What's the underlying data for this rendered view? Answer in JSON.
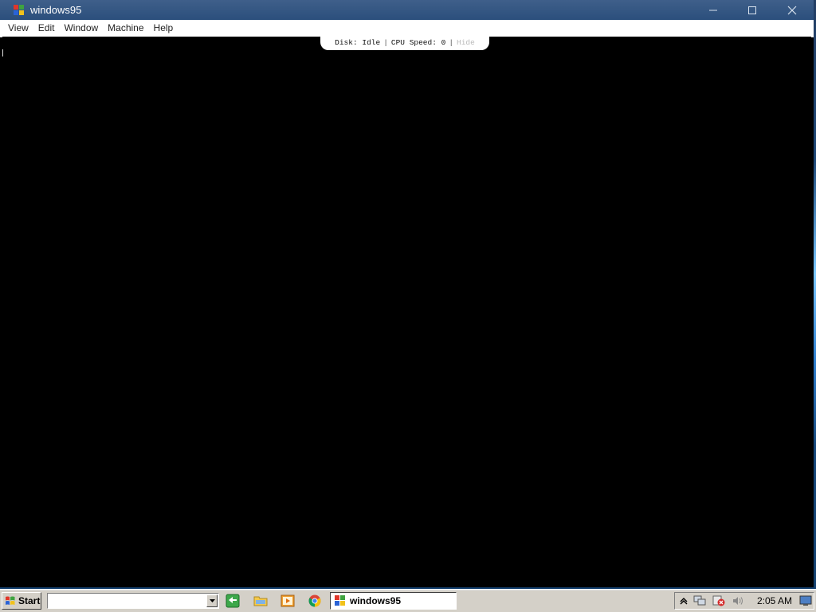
{
  "window": {
    "title": "windows95",
    "controls": {
      "minimize": "—",
      "maximize": "☐",
      "close": "✕"
    }
  },
  "menu": [
    "View",
    "Edit",
    "Window",
    "Machine",
    "Help"
  ],
  "status": {
    "disk_label": "Disk:",
    "disk_value": "Idle",
    "cpu_label": "CPU Speed:",
    "cpu_value": "0",
    "hide_label": "Hide",
    "separator": "|"
  },
  "taskbar": {
    "start_label": "Start",
    "address_value": "",
    "quick_launch": [
      "switch-desktop-icon",
      "folder-icon",
      "media-player-icon",
      "chrome-icon"
    ],
    "task_button_label": "windows95",
    "tray_icons": [
      "show-hidden-icons-icon",
      "network-icon",
      "security-alert-icon",
      "volume-icon"
    ],
    "clock": "2:05 AM"
  },
  "colors": {
    "titlebar": "#2b4f7c",
    "screen": "#000000",
    "taskbar": "#d4d0c8"
  }
}
